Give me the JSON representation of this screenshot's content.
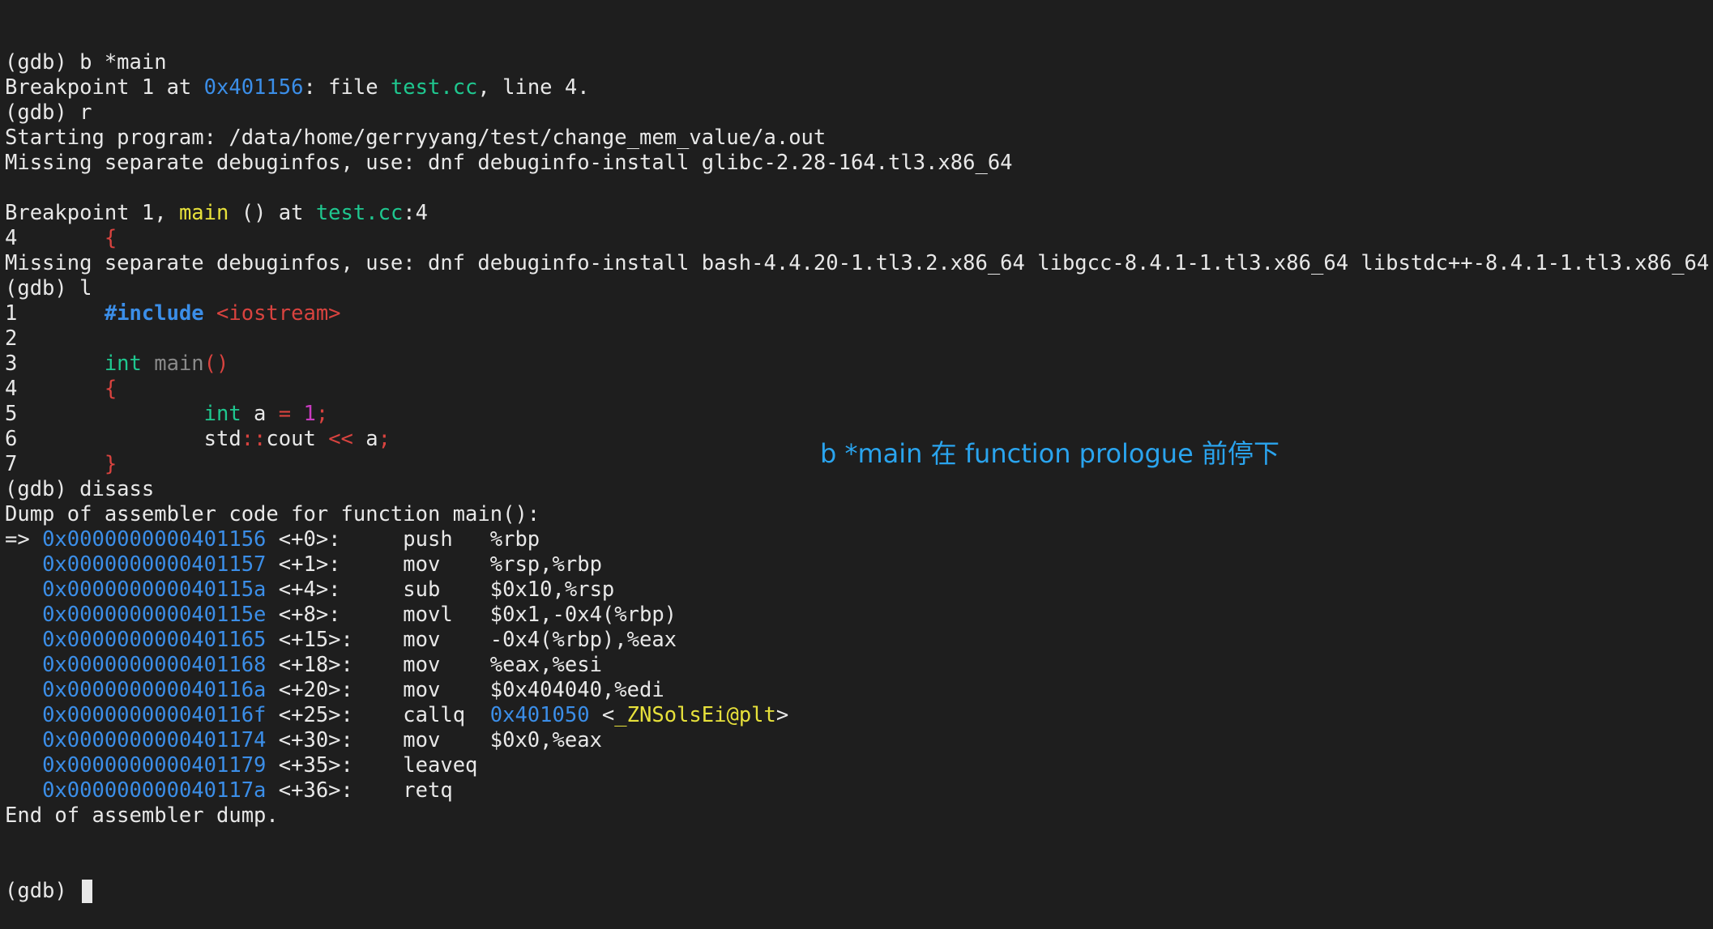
{
  "prompt": "(gdb)",
  "lines": [
    {
      "segs": [
        {
          "t": "(gdb) b *main"
        }
      ]
    },
    {
      "segs": [
        {
          "t": "Breakpoint 1 at "
        },
        {
          "t": "0x401156",
          "c": "addr"
        },
        {
          "t": ": file "
        },
        {
          "t": "test.cc",
          "c": "file"
        },
        {
          "t": ", line 4."
        }
      ]
    },
    {
      "segs": [
        {
          "t": "(gdb) r"
        }
      ]
    },
    {
      "segs": [
        {
          "t": "Starting program: /data/home/gerryyang/test/change_mem_value/a.out"
        }
      ]
    },
    {
      "segs": [
        {
          "t": "Missing separate debuginfos, use: dnf debuginfo-install glibc-2.28-164.tl3.x86_64"
        }
      ]
    },
    {
      "segs": []
    },
    {
      "segs": [
        {
          "t": "Breakpoint 1, "
        },
        {
          "t": "main",
          "c": "func"
        },
        {
          "t": " () at "
        },
        {
          "t": "test.cc",
          "c": "file"
        },
        {
          "t": ":4"
        }
      ]
    },
    {
      "segs": [
        {
          "t": "4       "
        },
        {
          "t": "{",
          "c": "red"
        }
      ]
    },
    {
      "segs": [
        {
          "t": "Missing separate debuginfos, use: dnf debuginfo-install bash-4.4.20-1.tl3.2.x86_64 libgcc-8.4.1-1.tl3.x86_64 libstdc++-8.4.1-1.tl3.x86_64"
        }
      ]
    },
    {
      "segs": [
        {
          "t": "(gdb) l"
        }
      ]
    },
    {
      "segs": [
        {
          "t": "1       "
        },
        {
          "t": "#include",
          "c": "kw"
        },
        {
          "t": " "
        },
        {
          "t": "<iostream>",
          "c": "red"
        }
      ]
    },
    {
      "segs": [
        {
          "t": "2"
        }
      ]
    },
    {
      "segs": [
        {
          "t": "3       "
        },
        {
          "t": "int",
          "c": "type"
        },
        {
          "t": " "
        },
        {
          "t": "main",
          "c": "gray"
        },
        {
          "t": "()",
          "c": "red"
        }
      ]
    },
    {
      "segs": [
        {
          "t": "4       "
        },
        {
          "t": "{",
          "c": "red"
        }
      ]
    },
    {
      "segs": [
        {
          "t": "5               "
        },
        {
          "t": "int",
          "c": "type"
        },
        {
          "t": " a "
        },
        {
          "t": "=",
          "c": "red"
        },
        {
          "t": " "
        },
        {
          "t": "1",
          "c": "num"
        },
        {
          "t": ";",
          "c": "red"
        }
      ]
    },
    {
      "segs": [
        {
          "t": "6               std"
        },
        {
          "t": "::",
          "c": "red"
        },
        {
          "t": "cout "
        },
        {
          "t": "<<",
          "c": "red"
        },
        {
          "t": " a"
        },
        {
          "t": ";",
          "c": "red"
        }
      ]
    },
    {
      "segs": [
        {
          "t": "7       "
        },
        {
          "t": "}",
          "c": "red"
        }
      ]
    },
    {
      "segs": [
        {
          "t": "(gdb) disass"
        }
      ]
    },
    {
      "segs": [
        {
          "t": "Dump of assembler code for function main():"
        }
      ]
    },
    {
      "segs": [
        {
          "t": "=> "
        },
        {
          "t": "0x0000000000401156",
          "c": "addr"
        },
        {
          "t": " <+0>:     push   %rbp"
        }
      ]
    },
    {
      "segs": [
        {
          "t": "   "
        },
        {
          "t": "0x0000000000401157",
          "c": "addr"
        },
        {
          "t": " <+1>:     mov    %rsp,%rbp"
        }
      ]
    },
    {
      "segs": [
        {
          "t": "   "
        },
        {
          "t": "0x000000000040115a",
          "c": "addr"
        },
        {
          "t": " <+4>:     sub    $0x10,%rsp"
        }
      ]
    },
    {
      "segs": [
        {
          "t": "   "
        },
        {
          "t": "0x000000000040115e",
          "c": "addr"
        },
        {
          "t": " <+8>:     movl   $0x1,-0x4(%rbp)"
        }
      ]
    },
    {
      "segs": [
        {
          "t": "   "
        },
        {
          "t": "0x0000000000401165",
          "c": "addr"
        },
        {
          "t": " <+15>:    mov    -0x4(%rbp),%eax"
        }
      ]
    },
    {
      "segs": [
        {
          "t": "   "
        },
        {
          "t": "0x0000000000401168",
          "c": "addr"
        },
        {
          "t": " <+18>:    mov    %eax,%esi"
        }
      ]
    },
    {
      "segs": [
        {
          "t": "   "
        },
        {
          "t": "0x000000000040116a",
          "c": "addr"
        },
        {
          "t": " <+20>:    mov    $0x404040,%edi"
        }
      ]
    },
    {
      "segs": [
        {
          "t": "   "
        },
        {
          "t": "0x000000000040116f",
          "c": "addr"
        },
        {
          "t": " <+25>:    callq  "
        },
        {
          "t": "0x401050",
          "c": "addr"
        },
        {
          "t": " <"
        },
        {
          "t": "_ZNSolsEi@plt",
          "c": "func"
        },
        {
          "t": ">"
        }
      ]
    },
    {
      "segs": [
        {
          "t": "   "
        },
        {
          "t": "0x0000000000401174",
          "c": "addr"
        },
        {
          "t": " <+30>:    mov    $0x0,%eax"
        }
      ]
    },
    {
      "segs": [
        {
          "t": "   "
        },
        {
          "t": "0x0000000000401179",
          "c": "addr"
        },
        {
          "t": " <+35>:    leaveq"
        }
      ]
    },
    {
      "segs": [
        {
          "t": "   "
        },
        {
          "t": "0x000000000040117a",
          "c": "addr"
        },
        {
          "t": " <+36>:    retq"
        }
      ]
    },
    {
      "segs": [
        {
          "t": "End of assembler dump."
        }
      ]
    }
  ],
  "annotation": "b *main 在 function prologue 前停下",
  "colors": {
    "background": "#1e1e1e",
    "text": "#e8e8e8",
    "addr": "#3b8ee8",
    "file": "#1fc78f",
    "func": "#e7e13b",
    "red": "#d9433f",
    "annotation": "#2aa4ee"
  }
}
